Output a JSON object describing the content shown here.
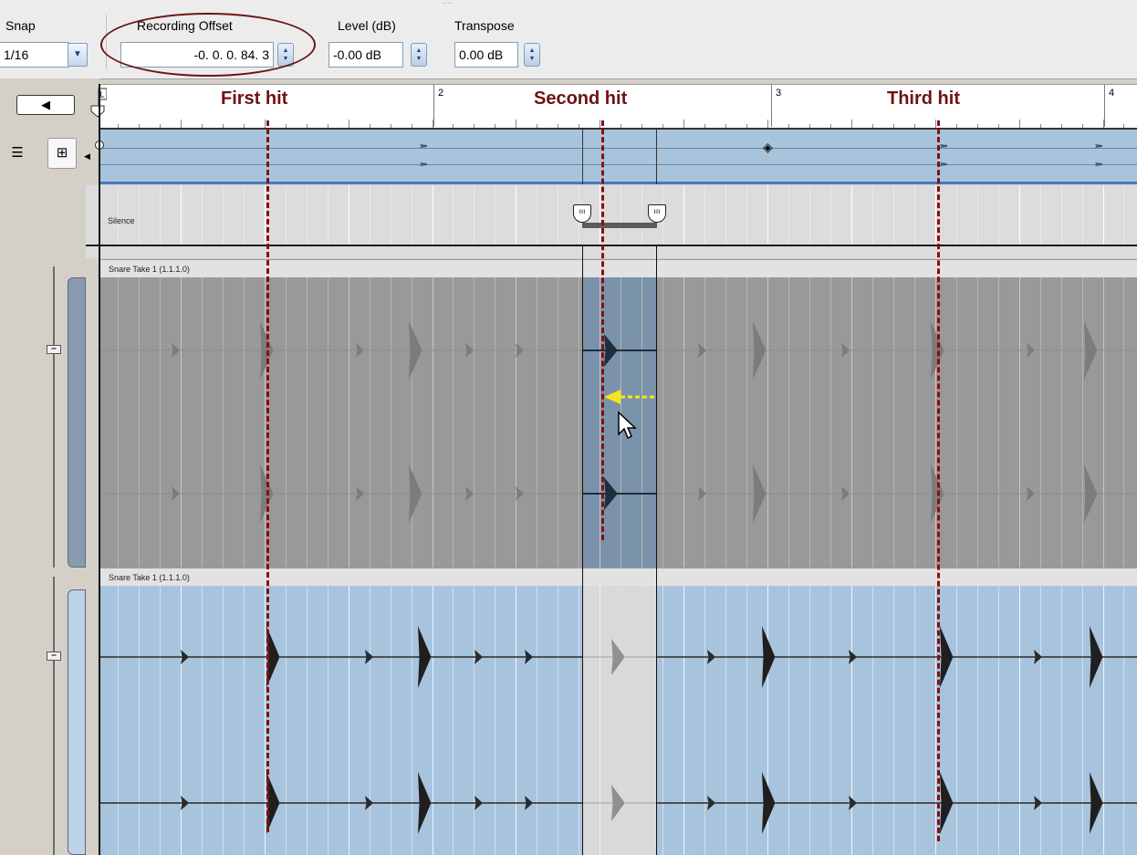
{
  "toolbar": {
    "snap_label": "Snap",
    "snap_value": "1/16",
    "offset_label": "Recording Offset",
    "offset_value": "-0.  0.  0.  84.  3",
    "level_label": "Level (dB)",
    "level_value": "-0.00 dB",
    "transpose_label": "Transpose",
    "transpose_value": "0.00 dB"
  },
  "ruler": {
    "measures": [
      "2",
      "3",
      "4"
    ],
    "locator_label": "L"
  },
  "annotations": {
    "first_hit": "First hit",
    "second_hit": "Second hit",
    "third_hit": "Third hit"
  },
  "lanes": {
    "silence_label": "Silence",
    "gray_track_label": "Snare Take 1 (1.1.1.0)",
    "blue_track_label": "Snare Take 1 (1.1.1.0)"
  },
  "buttons": {
    "back_glyph": "◀",
    "view_list_glyph": "☰",
    "view_tree_glyph": "⊞"
  },
  "colors": {
    "annotation": "#6e1212",
    "track_blue": "#a8c4dd",
    "track_gray": "#999999",
    "selection": "#7a93ab",
    "arrow": "#f5e61a"
  }
}
